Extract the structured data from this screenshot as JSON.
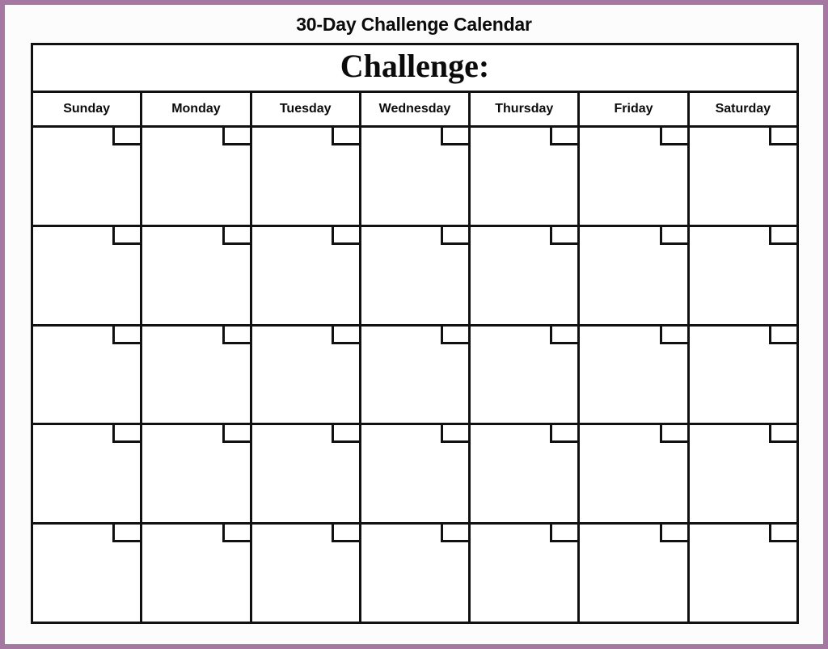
{
  "document": {
    "title": "30-Day Challenge Calendar"
  },
  "theme": {
    "border_color": "#a478a0",
    "grid_color": "#111111",
    "page_background": "#fdfcfc",
    "cell_background": "#ffffff",
    "text_color": "#0b0b0b"
  },
  "calendar": {
    "banner_label": "Challenge:",
    "weekdays": [
      {
        "label": "Sunday"
      },
      {
        "label": "Monday"
      },
      {
        "label": "Tuesday"
      },
      {
        "label": "Wednesday"
      },
      {
        "label": "Thursday"
      },
      {
        "label": "Friday"
      },
      {
        "label": "Saturday"
      }
    ],
    "weeks": [
      {
        "days": [
          {
            "date": "",
            "note": ""
          },
          {
            "date": "",
            "note": ""
          },
          {
            "date": "",
            "note": ""
          },
          {
            "date": "",
            "note": ""
          },
          {
            "date": "",
            "note": ""
          },
          {
            "date": "",
            "note": ""
          },
          {
            "date": "",
            "note": ""
          }
        ]
      },
      {
        "days": [
          {
            "date": "",
            "note": ""
          },
          {
            "date": "",
            "note": ""
          },
          {
            "date": "",
            "note": ""
          },
          {
            "date": "",
            "note": ""
          },
          {
            "date": "",
            "note": ""
          },
          {
            "date": "",
            "note": ""
          },
          {
            "date": "",
            "note": ""
          }
        ]
      },
      {
        "days": [
          {
            "date": "",
            "note": ""
          },
          {
            "date": "",
            "note": ""
          },
          {
            "date": "",
            "note": ""
          },
          {
            "date": "",
            "note": ""
          },
          {
            "date": "",
            "note": ""
          },
          {
            "date": "",
            "note": ""
          },
          {
            "date": "",
            "note": ""
          }
        ]
      },
      {
        "days": [
          {
            "date": "",
            "note": ""
          },
          {
            "date": "",
            "note": ""
          },
          {
            "date": "",
            "note": ""
          },
          {
            "date": "",
            "note": ""
          },
          {
            "date": "",
            "note": ""
          },
          {
            "date": "",
            "note": ""
          },
          {
            "date": "",
            "note": ""
          }
        ]
      },
      {
        "days": [
          {
            "date": "",
            "note": ""
          },
          {
            "date": "",
            "note": ""
          },
          {
            "date": "",
            "note": ""
          },
          {
            "date": "",
            "note": ""
          },
          {
            "date": "",
            "note": ""
          },
          {
            "date": "",
            "note": ""
          },
          {
            "date": "",
            "note": ""
          }
        ]
      }
    ]
  }
}
